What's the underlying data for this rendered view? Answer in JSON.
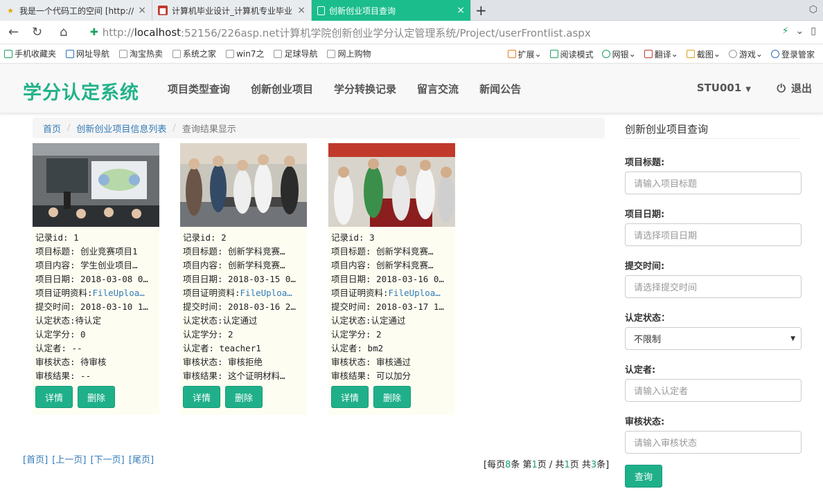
{
  "browser": {
    "tabs": [
      {
        "title": "我是一个代码工的空间 [http://2",
        "active": false
      },
      {
        "title": "计算机毕业设计_计算机专业毕业",
        "active": false
      },
      {
        "title": "创新创业项目查询",
        "active": true
      }
    ],
    "url_prefix": "http://",
    "url_host": "localhost",
    "url_rest": ":52156/226asp.net计算机学院创新创业学分认定管理系统/Project/userFrontlist.aspx",
    "bookmarks": [
      "手机收藏夹",
      "网址导航",
      "淘宝热卖",
      "系统之家",
      "win7之",
      "足球导航",
      "网上购物"
    ],
    "bookmarks_right": [
      "扩展",
      "阅读模式",
      "网银",
      "翻译",
      "截图",
      "游戏",
      "登录管家"
    ]
  },
  "header": {
    "brand": "学分认定系统",
    "menu": [
      "项目类型查询",
      "创新创业项目",
      "学分转换记录",
      "留言交流",
      "新闻公告"
    ],
    "user": "STU001",
    "logout": "退出"
  },
  "breadcrumb": {
    "home": "首页",
    "list": "创新创业项目信息列表",
    "current": "查询结果显示"
  },
  "cards": [
    {
      "lines": [
        "记录id: 1",
        "项目标题: 创业竞赛项目1",
        "项目内容: 学生创业项目…",
        "项目日期: 2018-03-08 0…",
        "项目证明资料:FileUploa…",
        "提交时间: 2018-03-10 1…",
        "认定状态:待认定",
        "认定学分: 0",
        "认定者: --",
        "审核状态: 待审核",
        "审核结果: --"
      ],
      "detail": "详情",
      "delete": "删除"
    },
    {
      "lines": [
        "记录id: 2",
        "项目标题: 创新学科竞赛…",
        "项目内容: 创新学科竞赛…",
        "项目日期: 2018-03-15 0…",
        "项目证明资料:FileUploa…",
        "提交时间: 2018-03-16 2…",
        "认定状态:认定通过",
        "认定学分: 2",
        "认定者: teacher1",
        "审核状态: 审核拒绝",
        "审核结果: 这个证明材料…"
      ],
      "detail": "详情",
      "delete": "删除"
    },
    {
      "lines": [
        "记录id: 3",
        "项目标题: 创新学科竞赛…",
        "项目内容: 创新学科竞赛…",
        "项目日期: 2018-03-16 0…",
        "项目证明资料:FileUploa…",
        "提交时间: 2018-03-17 1…",
        "认定状态:认定通过",
        "认定学分: 2",
        "认定者: bm2",
        "审核状态: 审核通过",
        "审核结果: 可以加分"
      ],
      "detail": "详情",
      "delete": "删除"
    }
  ],
  "pager": {
    "first": "[首页]",
    "prev": "[上一页]",
    "next": "[下一页]",
    "last": "[尾页]",
    "info_a": "[每页",
    "per_page": "8",
    "info_b": "条 第",
    "page": "1",
    "info_c": "页 / 共",
    "pages": "1",
    "info_d": "页 共",
    "total": "3",
    "info_e": "条]"
  },
  "search": {
    "title": "创新创业项目查询",
    "fields": [
      {
        "label": "项目标题:",
        "placeholder": "请输入项目标题"
      },
      {
        "label": "项目日期:",
        "placeholder": "请选择项目日期"
      },
      {
        "label": "提交时间:",
        "placeholder": "请选择提交时间"
      },
      {
        "label": "认定状态：",
        "value": "不限制"
      },
      {
        "label": "认定者:",
        "placeholder": "请输入认定者"
      },
      {
        "label": "审核状态:",
        "placeholder": "请输入审核状态"
      }
    ],
    "submit": "查询"
  }
}
